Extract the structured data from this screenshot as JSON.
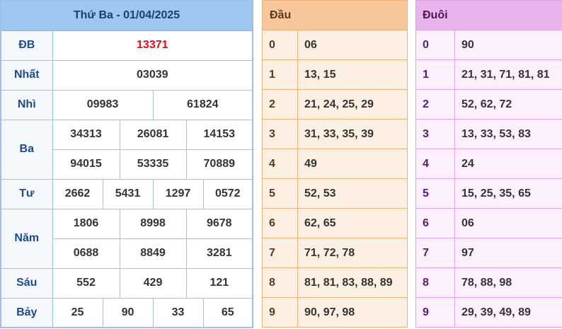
{
  "results": {
    "title": "Thứ Ba - 01/04/2025",
    "prizes": [
      {
        "label": "ĐB",
        "values": [
          "13371"
        ]
      },
      {
        "label": "Nhất",
        "values": [
          "03039"
        ]
      },
      {
        "label": "Nhì",
        "values": [
          "09983",
          "61824"
        ]
      },
      {
        "label": "Ba",
        "values": [
          "34313",
          "26081",
          "14153",
          "94015",
          "53335",
          "70889"
        ]
      },
      {
        "label": "Tư",
        "values": [
          "2662",
          "5431",
          "1297",
          "0572"
        ]
      },
      {
        "label": "Năm",
        "values": [
          "1806",
          "8998",
          "9678",
          "0688",
          "8849",
          "3281"
        ]
      },
      {
        "label": "Sáu",
        "values": [
          "552",
          "429",
          "121"
        ]
      },
      {
        "label": "Bảy",
        "values": [
          "25",
          "90",
          "33",
          "65"
        ]
      }
    ]
  },
  "dau": {
    "header": "Đầu",
    "rows": [
      {
        "key": "0",
        "val": "06"
      },
      {
        "key": "1",
        "val": "13, 15"
      },
      {
        "key": "2",
        "val": "21, 24, 25, 29"
      },
      {
        "key": "3",
        "val": "31, 33, 35, 39"
      },
      {
        "key": "4",
        "val": "49"
      },
      {
        "key": "5",
        "val": "52, 53"
      },
      {
        "key": "6",
        "val": "62, 65"
      },
      {
        "key": "7",
        "val": "71, 72, 78"
      },
      {
        "key": "8",
        "val": "81, 81, 83, 88, 89"
      },
      {
        "key": "9",
        "val": "90, 97, 98"
      }
    ]
  },
  "duoi": {
    "header": "Đuôi",
    "rows": [
      {
        "key": "0",
        "val": "90"
      },
      {
        "key": "1",
        "val": "21, 31, 71, 81, 81"
      },
      {
        "key": "2",
        "val": "52, 62, 72"
      },
      {
        "key": "3",
        "val": "13, 33, 53, 83"
      },
      {
        "key": "4",
        "val": "24"
      },
      {
        "key": "5",
        "val": "15, 25, 35, 65"
      },
      {
        "key": "6",
        "val": "06"
      },
      {
        "key": "7",
        "val": "97"
      },
      {
        "key": "8",
        "val": "78, 88, 98"
      },
      {
        "key": "9",
        "val": "29, 39, 49, 89"
      }
    ]
  },
  "colors": {
    "special_prize": "#e00b16",
    "main_header": "#9fc5f1",
    "dau_header": "#f7c69a",
    "duoi_header": "#e9b4ee"
  }
}
